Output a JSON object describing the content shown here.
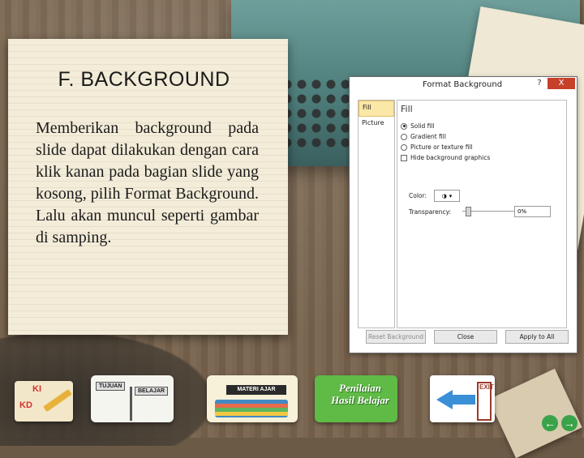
{
  "note": {
    "title": "F. BACKGROUND",
    "body": "Memberikan background pada slide dapat dilakukan dengan cara klik kanan pada bagian slide yang kosong, pilih Format Background. Lalu akan muncul seperti gambar di samping."
  },
  "dialog": {
    "title": "Format Background",
    "help": "?",
    "close": "X",
    "nav_items": [
      "Fill",
      "Picture"
    ],
    "pane_title": "Fill",
    "options": [
      {
        "label": "Solid fill",
        "type": "radio",
        "selected": true
      },
      {
        "label": "Gradient fill",
        "type": "radio",
        "selected": false
      },
      {
        "label": "Picture or texture fill",
        "type": "radio",
        "selected": false
      },
      {
        "label": "Hide background graphics",
        "type": "checkbox",
        "selected": false
      }
    ],
    "color_label": "Color:",
    "transparency_label": "Transparency:",
    "transparency_value": "0%",
    "reset_button": "Reset Background",
    "close_button": "Close",
    "apply_all_button": "Apply to All"
  },
  "nav_buttons": {
    "kikd_top": "KI",
    "kikd_bottom": "KD",
    "tujuan_left": "TUJUAN",
    "tujuan_right": "BELAJAR",
    "materi": "MATERI AJAR",
    "penilaian": "Penilaian Hasil Belajar",
    "exit": "EXIT"
  },
  "colors": {
    "dialog_close": "#c7402a",
    "nav_active": "#fbe7a6",
    "penilaian_bg": "#5fba46"
  }
}
